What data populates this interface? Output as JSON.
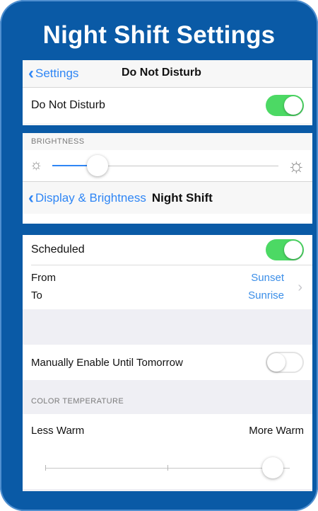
{
  "card_title": "Night Shift Settings",
  "dnd_screen": {
    "back_label": "Settings",
    "title": "Do Not Disturb",
    "row_label": "Do Not Disturb",
    "toggle_on": true
  },
  "brightness_screen": {
    "section_header": "BRIGHTNESS",
    "brightness_level": 0.2,
    "back_label": "Display & Brightness",
    "title": "Night Shift"
  },
  "night_shift": {
    "scheduled_label": "Scheduled",
    "scheduled_on": true,
    "from_label": "From",
    "to_label": "To",
    "from_value": "Sunset",
    "to_value": "Sunrise",
    "manual_label": "Manually Enable Until Tomorrow",
    "manual_on": false,
    "color_temp_header": "COLOR TEMPERATURE",
    "less_warm_label": "Less Warm",
    "more_warm_label": "More Warm",
    "warmth_level": 0.93
  },
  "icons": {
    "back": "chevron-left-icon",
    "sun_small": "sun-small-icon",
    "sun_large": "sun-large-icon",
    "disclosure": "chevron-right-icon"
  },
  "colors": {
    "card_background": "#0a5aa6",
    "ios_blue": "#2f86f5",
    "toggle_green": "#4cd964"
  }
}
